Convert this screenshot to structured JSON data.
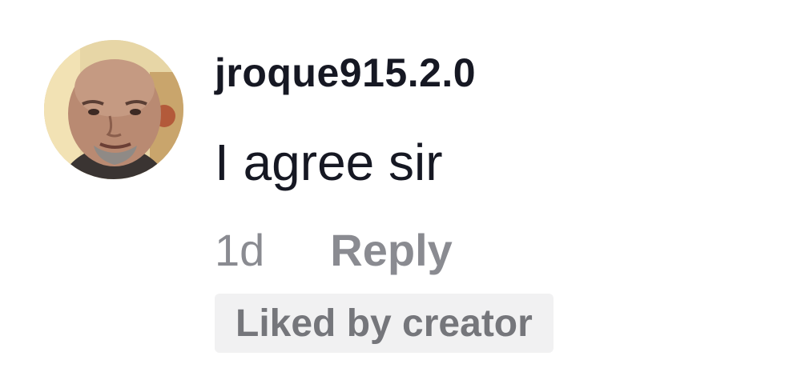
{
  "comment": {
    "avatar_icon": "user-avatar-photo",
    "username": "jroque915.2.0",
    "text": "I agree sir",
    "time": "1d",
    "reply_label": "Reply",
    "liked_badge": "Liked by creator"
  },
  "colors": {
    "primary_text": "#161823",
    "secondary_text": "#8a8b91",
    "badge_bg": "#f1f1f2",
    "badge_text": "#75767b"
  }
}
